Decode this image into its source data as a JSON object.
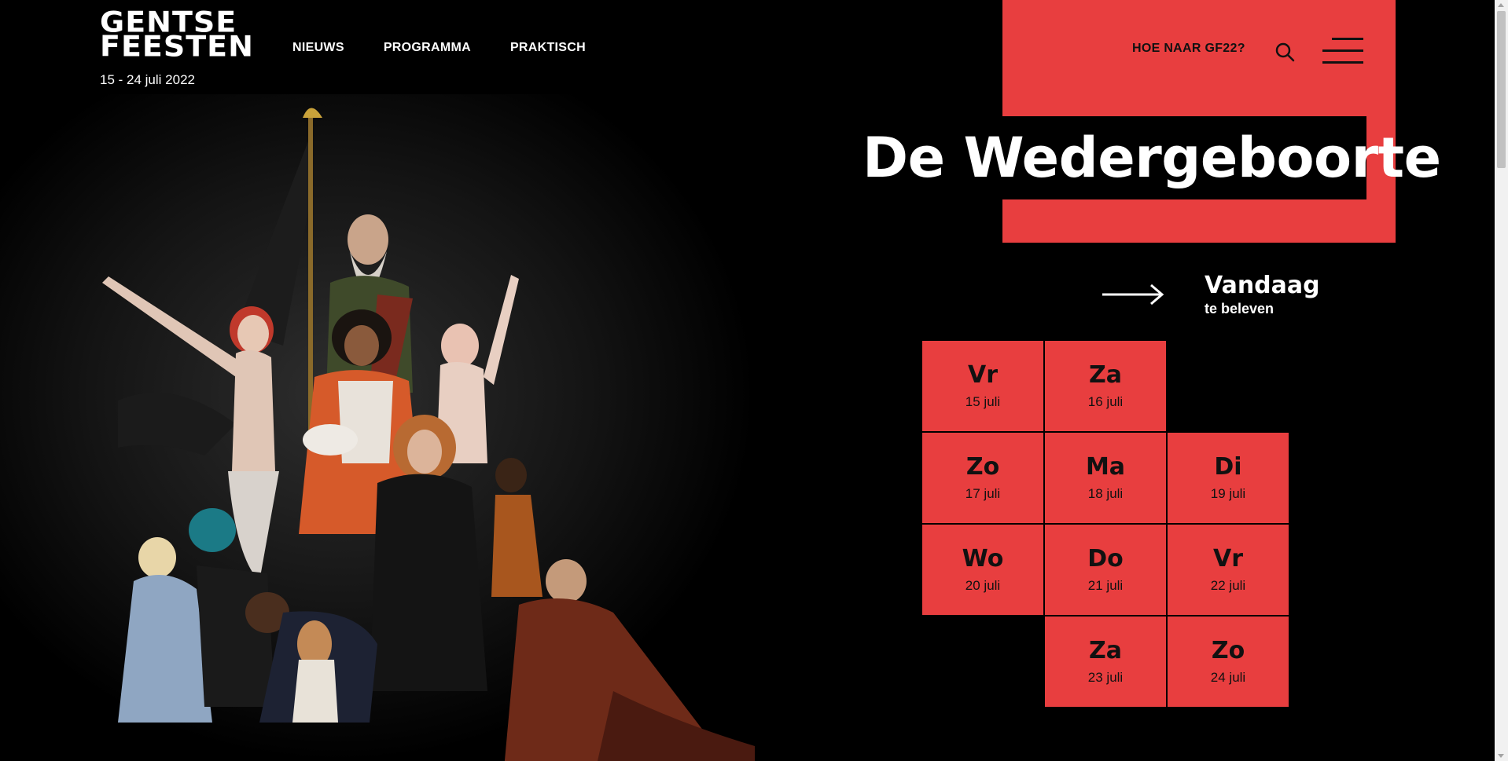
{
  "logo": {
    "line1": "GENTSE",
    "line2": "FEESTEN"
  },
  "dates": "15 - 24 juli 2022",
  "nav": [
    "NIEUWS",
    "PROGRAMMA",
    "PRAKTISCH"
  ],
  "header": {
    "hoe_naar": "HOE NAAR GF22?",
    "search_icon": "search-icon",
    "menu_icon": "hamburger-menu-icon"
  },
  "title": "De Wedergeboorte",
  "today": {
    "label": "Vandaag",
    "sub": "te beleven",
    "icon": "arrow-right-icon"
  },
  "calendar": [
    {
      "day": "Vr",
      "date": "15 juli"
    },
    {
      "day": "Za",
      "date": "16 juli"
    },
    {
      "day": "Zo",
      "date": "17 juli"
    },
    {
      "day": "Ma",
      "date": "18 juli"
    },
    {
      "day": "Di",
      "date": "19 juli"
    },
    {
      "day": "Wo",
      "date": "20 juli"
    },
    {
      "day": "Do",
      "date": "21 juli"
    },
    {
      "day": "Vr",
      "date": "22 juli"
    },
    {
      "day": "Za",
      "date": "23 juli"
    },
    {
      "day": "Zo",
      "date": "24 juli"
    }
  ],
  "colors": {
    "accent": "#e83e3f",
    "background": "#000000",
    "text": "#ffffff"
  }
}
